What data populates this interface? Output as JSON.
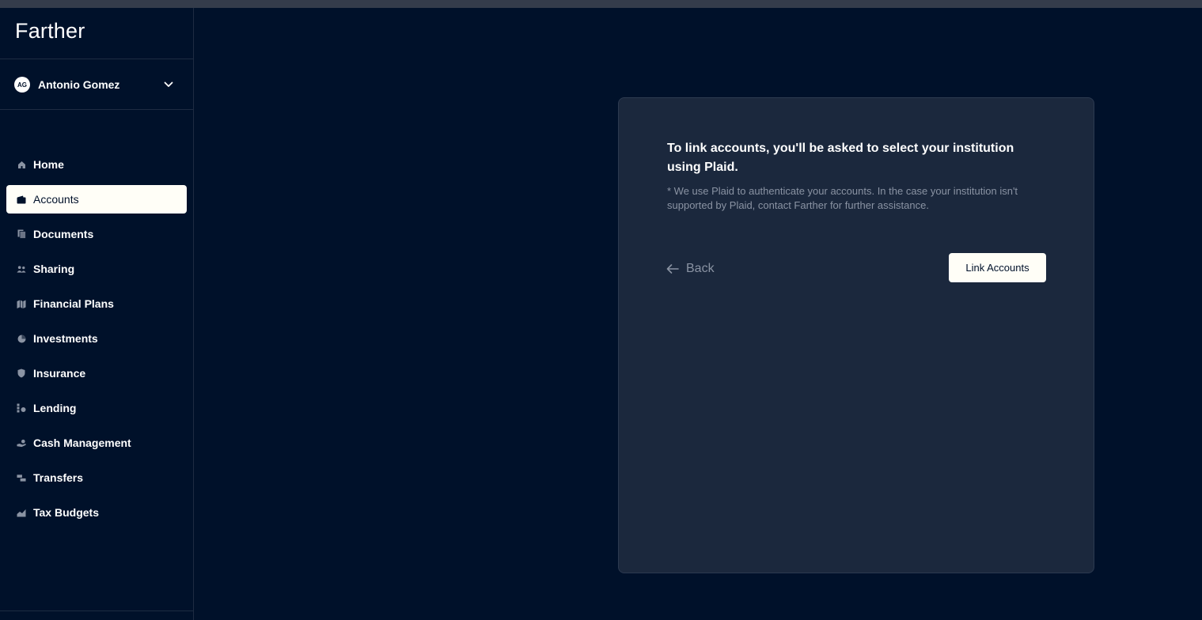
{
  "app": {
    "logo": "Farther"
  },
  "user": {
    "initials": "AG",
    "name": "Antonio Gomez"
  },
  "sidebar": {
    "items": [
      {
        "label": "Home",
        "icon": "home-icon",
        "active": false
      },
      {
        "label": "Accounts",
        "icon": "wallet-icon",
        "active": true
      },
      {
        "label": "Documents",
        "icon": "documents-icon",
        "active": false
      },
      {
        "label": "Sharing",
        "icon": "people-icon",
        "active": false
      },
      {
        "label": "Financial Plans",
        "icon": "map-icon",
        "active": false
      },
      {
        "label": "Investments",
        "icon": "pie-chart-icon",
        "active": false
      },
      {
        "label": "Insurance",
        "icon": "shield-icon",
        "active": false
      },
      {
        "label": "Lending",
        "icon": "lending-icon",
        "active": false
      },
      {
        "label": "Cash Management",
        "icon": "cash-hand-icon",
        "active": false
      },
      {
        "label": "Transfers",
        "icon": "transfer-icon",
        "active": false
      },
      {
        "label": "Tax Budgets",
        "icon": "chart-area-icon",
        "active": false
      }
    ]
  },
  "card": {
    "title": "To link accounts, you'll be asked to select your institution using Plaid.",
    "note": "* We use Plaid to authenticate your accounts. In the case your institution isn't supported by Plaid, contact Farther for further assistance.",
    "back_label": "Back",
    "link_label": "Link Accounts"
  },
  "colors": {
    "background": "#00112a",
    "card": "#1b283d",
    "active_item": "#fffef7",
    "muted_text": "#8a93a3"
  }
}
